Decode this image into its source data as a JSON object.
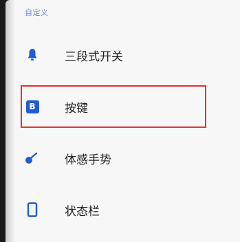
{
  "section": {
    "header": "自定义"
  },
  "items": [
    {
      "label": "三段式开关",
      "icon": "alert-slider-icon"
    },
    {
      "label": "按键",
      "icon": "buttons-b-icon",
      "icon_letter": "B"
    },
    {
      "label": "体感手势",
      "icon": "gesture-icon"
    },
    {
      "label": "状态栏",
      "icon": "status-bar-phone-icon"
    }
  ],
  "colors": {
    "accent": "#1e5bd8",
    "header": "#6f86d6",
    "highlight": "#e2332f",
    "background": "#f7f7f7"
  }
}
